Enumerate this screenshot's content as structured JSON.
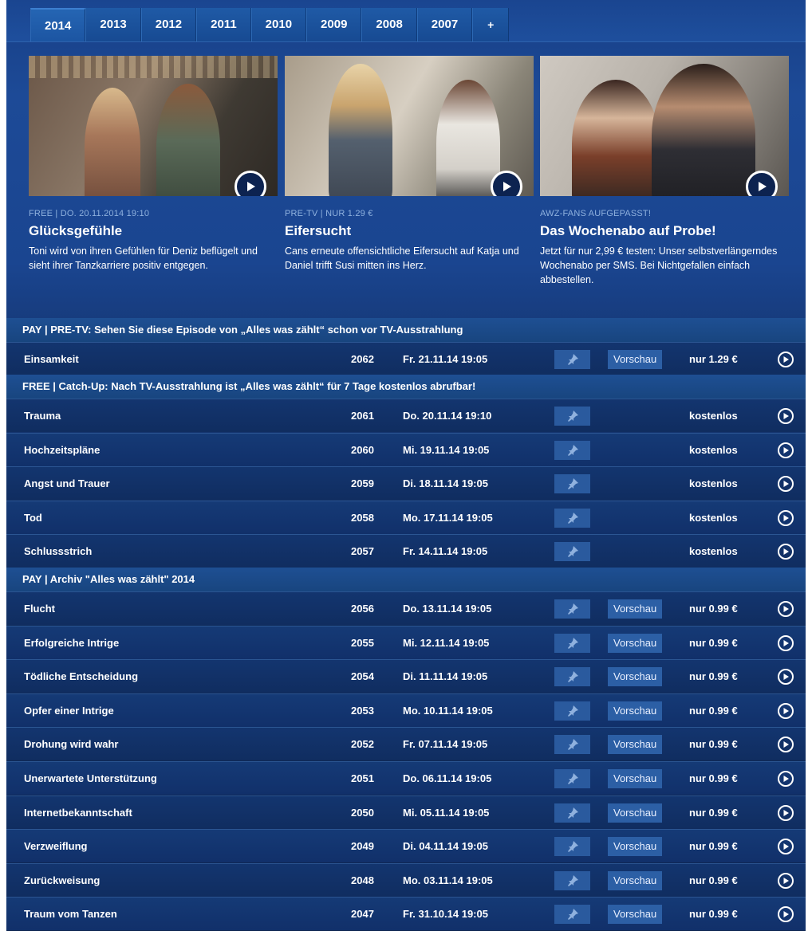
{
  "tabs": [
    "2014",
    "2013",
    "2012",
    "2011",
    "2010",
    "2009",
    "2008",
    "2007",
    "+"
  ],
  "active_tab": 0,
  "teasers": [
    {
      "meta": "FREE | DO. 20.11.2014 19:10",
      "title": "Glücksgefühle",
      "desc": "Toni wird von ihren Gefühlen für Deniz beflügelt und sieht ihrer Tanzkarriere positiv entgegen."
    },
    {
      "meta": "PRE-TV | NUR 1.29 €",
      "title": "Eifersucht",
      "desc": "Cans erneute offensichtliche Eifersucht auf Katja und Daniel trifft Susi mitten ins Herz."
    },
    {
      "meta": "AWZ-FANS AUFGEPASST!",
      "title": "Das Wochenabo auf Probe!",
      "desc": "Jetzt für nur 2,99 € testen: Unser selbstverlängerndes Wochenabo per SMS. Bei Nichtgefallen einfach abbestellen."
    }
  ],
  "sections": [
    {
      "header": "PAY | PRE-TV: Sehen Sie diese Episode von „Alles was zählt“ schon vor TV-Ausstrahlung",
      "rows": [
        {
          "title": "Einsamkeit",
          "num": "2062",
          "date": "Fr. 21.11.14 19:05",
          "preview": "Vorschau",
          "price": "nur 1.29 €"
        }
      ]
    },
    {
      "header": "FREE | Catch-Up: Nach TV-Ausstrahlung ist „Alles was zählt“ für 7 Tage kostenlos abrufbar!",
      "rows": [
        {
          "title": "Trauma",
          "num": "2061",
          "date": "Do. 20.11.14 19:10",
          "preview": "",
          "price": "kostenlos"
        },
        {
          "title": "Hochzeitspläne",
          "num": "2060",
          "date": "Mi.  19.11.14 19:05",
          "preview": "",
          "price": "kostenlos"
        },
        {
          "title": "Angst und Trauer",
          "num": "2059",
          "date": "Di.  18.11.14 19:05",
          "preview": "",
          "price": "kostenlos"
        },
        {
          "title": "Tod",
          "num": "2058",
          "date": "Mo. 17.11.14 19:05",
          "preview": "",
          "price": "kostenlos"
        },
        {
          "title": "Schlussstrich",
          "num": "2057",
          "date": "Fr.  14.11.14 19:05",
          "preview": "",
          "price": "kostenlos"
        }
      ]
    },
    {
      "header": "PAY | Archiv \"Alles was zählt\" 2014",
      "rows": [
        {
          "title": "Flucht",
          "num": "2056",
          "date": "Do. 13.11.14 19:05",
          "preview": "Vorschau",
          "price": "nur 0.99 €"
        },
        {
          "title": "Erfolgreiche Intrige",
          "num": "2055",
          "date": "Mi.  12.11.14 19:05",
          "preview": "Vorschau",
          "price": "nur 0.99 €"
        },
        {
          "title": "Tödliche Entscheidung",
          "num": "2054",
          "date": "Di.  11.11.14 19:05",
          "preview": "Vorschau",
          "price": "nur 0.99 €"
        },
        {
          "title": "Opfer einer Intrige",
          "num": "2053",
          "date": "Mo. 10.11.14 19:05",
          "preview": "Vorschau",
          "price": "nur 0.99 €"
        },
        {
          "title": "Drohung wird wahr",
          "num": "2052",
          "date": "Fr.  07.11.14 19:05",
          "preview": "Vorschau",
          "price": "nur 0.99 €"
        },
        {
          "title": "Unerwartete Unterstützung",
          "num": "2051",
          "date": "Do. 06.11.14 19:05",
          "preview": "Vorschau",
          "price": "nur 0.99 €"
        },
        {
          "title": "Internetbekanntschaft",
          "num": "2050",
          "date": "Mi.  05.11.14 19:05",
          "preview": "Vorschau",
          "price": "nur 0.99 €"
        },
        {
          "title": "Verzweiflung",
          "num": "2049",
          "date": "Di.  04.11.14 19:05",
          "preview": "Vorschau",
          "price": "nur 0.99 €"
        },
        {
          "title": "Zurückweisung",
          "num": "2048",
          "date": "Mo. 03.11.14 19:05",
          "preview": "Vorschau",
          "price": "nur 0.99 €"
        },
        {
          "title": "Traum vom Tanzen",
          "num": "2047",
          "date": "Fr.  31.10.14 19:05",
          "preview": "Vorschau",
          "price": "nur 0.99 €"
        }
      ]
    }
  ],
  "icons": {
    "play": "play-circle-icon",
    "pin": "pin-icon"
  }
}
